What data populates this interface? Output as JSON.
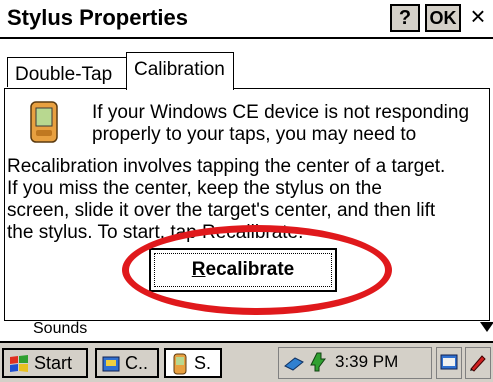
{
  "window": {
    "title": "Stylus Properties",
    "help_label": "?",
    "ok_label": "OK",
    "close_label": "×"
  },
  "tabs": [
    {
      "label": "Double-Tap",
      "selected": false
    },
    {
      "label": "Calibration",
      "selected": true
    }
  ],
  "calibration": {
    "intro_line1": "If your Windows CE device is not responding",
    "intro_line2": "properly to your taps, you may need to",
    "body_lines": [
      "Recalibration involves tapping the center of a target.",
      "If you miss the center, keep the stylus on the",
      "screen, slide it over the target's center, and then lift",
      "the stylus. To start, tap Recalibrate."
    ],
    "recalibrate_label": "Recalibrate"
  },
  "background": {
    "list_item": "Sounds"
  },
  "taskbar": {
    "start_label": "Start",
    "task1_label": "C..",
    "task2_label": "S.",
    "clock": "3:39 PM"
  },
  "colors": {
    "highlight_ellipse": "#e0191c",
    "taskbar_bg": "#d4d0c8"
  }
}
